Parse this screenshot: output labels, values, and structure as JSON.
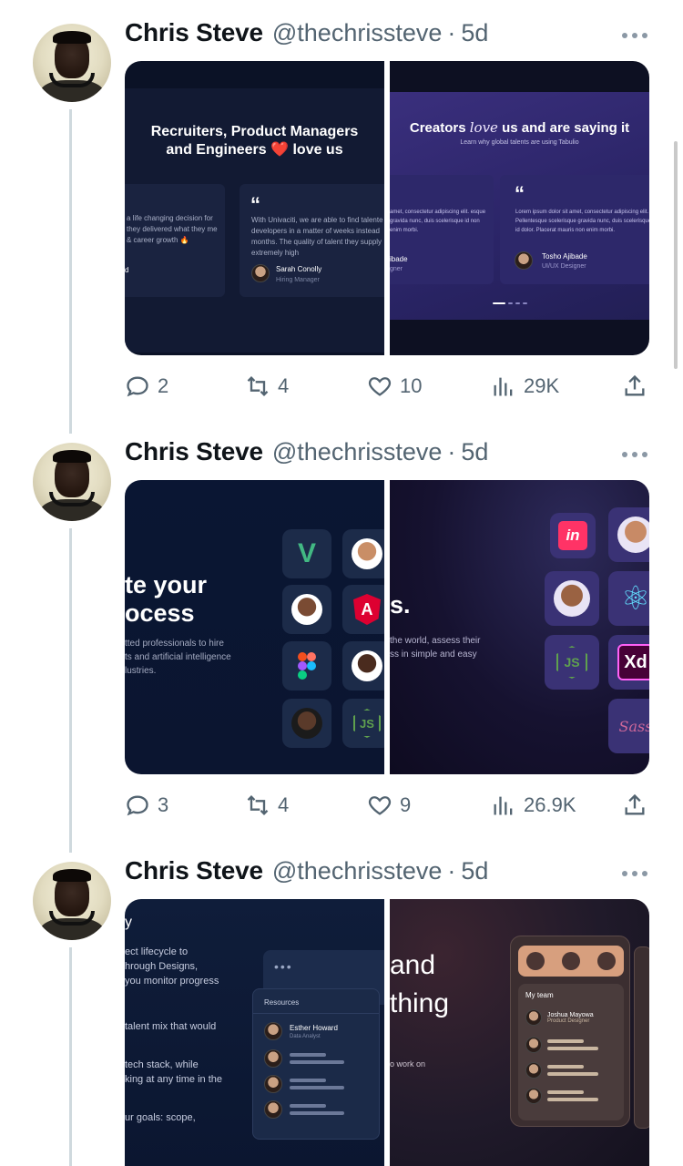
{
  "tweets": [
    {
      "author_name": "Chris Steve",
      "handle": "@thechrissteve",
      "separator": "·",
      "time": "5d",
      "media_left": {
        "title_line1": "Recruiters, Product Managers",
        "title_line2": "and Engineers",
        "title_heart": "❤️",
        "title_tail": "love us",
        "card_a_text": "a life changing decision for they delivered what they me & career growth 🔥",
        "card_a_suffix": "d",
        "quote_mark": "“",
        "card_b_text": "With Univaciti, we are able to find talente developers in a matter of weeks instead months. The quality of talent they supply extremely high",
        "card_b_name": "Sarah Conolly",
        "card_b_role": "Hiring Manager"
      },
      "media_right": {
        "title_pre": "Creators",
        "title_love": "love",
        "title_post": "us and are saying it",
        "subtitle": "Learn why global talents are using Tabulio",
        "card_a_text": "amet, consectetur adipiscing elit. esque gravida nunc, duis scelerisque id non enim morbi.",
        "card_a_name": "ibade",
        "card_a_role": "gner",
        "quote_mark": "“",
        "card_b_text": "Lorem ipsum dolor sit amet, consectetur adipiscing elit. Pellentesque scelerisque gravida nunc, duis scelerisque id dolor. Placerat mauris non enim morbi.",
        "card_b_name": "Tosho Ajibade",
        "card_b_role": "UI/UX Designer"
      },
      "replies": "2",
      "retweets": "4",
      "likes": "10",
      "views": "29K"
    },
    {
      "author_name": "Chris Steve",
      "handle": "@thechrissteve",
      "separator": "·",
      "time": "5d",
      "media_left": {
        "headline_line1": "te your",
        "headline_line2": "ocess",
        "body_line1": "tted professionals to hire",
        "body_line2": "ts and artificial intelligence",
        "body_line3": "lustries.",
        "tile_labels": [
          "V",
          "A",
          "JS"
        ]
      },
      "media_right": {
        "headline": "s.",
        "body_line1": "the world, assess their",
        "body_line2": "ss in simple and easy",
        "tile_labels": [
          "in",
          "⚛",
          "JS",
          "Xd",
          "Sass"
        ]
      },
      "replies": "3",
      "retweets": "4",
      "likes": "9",
      "views": "26.9K"
    },
    {
      "author_name": "Chris Steve",
      "handle": "@thechrissteve",
      "separator": "·",
      "time": "5d",
      "media_left": {
        "corner_mark": "y",
        "para1_line1": "ect lifecycle to",
        "para1_line2": "hrough Designs,",
        "para1_line3": "you monitor progress",
        "para2_line1": "talent mix that would",
        "para3_line1": "tech stack, while",
        "para3_line2": "king at any time in the",
        "para4_line1": "ur goals: scope,",
        "panel_dots": "•••",
        "resources_label": "Resources",
        "resource_name": "Esther Howard",
        "resource_role": "Data Analyst"
      },
      "media_right": {
        "headline_line1": "and",
        "headline_line2": "thing",
        "body": "o work on",
        "team_label": "My team",
        "member_name": "Joshua Mayowa",
        "member_role": "Product Designer"
      },
      "replies": "",
      "retweets": "",
      "likes": "",
      "views": ""
    }
  ]
}
